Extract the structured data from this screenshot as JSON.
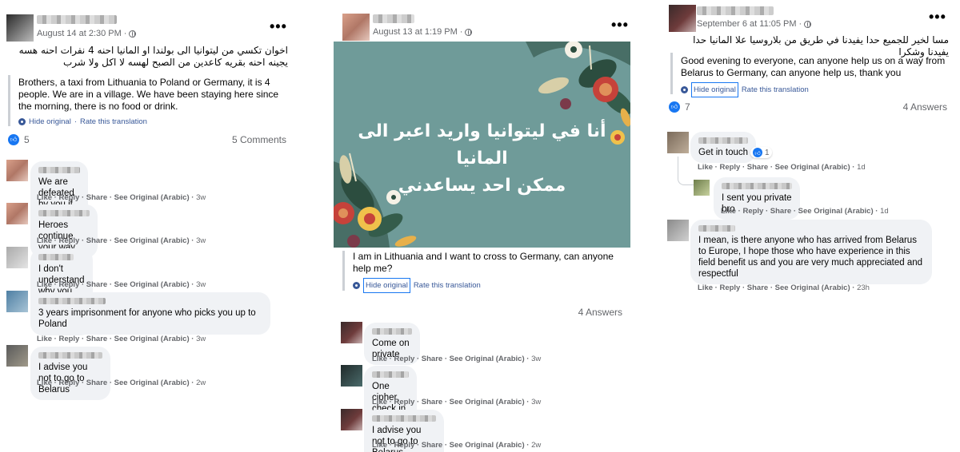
{
  "post1": {
    "date": "August 14 at 2:30 PM",
    "original_text": "اخوان تكسي من ليتوانيا الى بولندا او المانيا احنه 4 نفرات احنه هسه يجينه احنه بقريه كاعدين من الصبح لهسه لا اكل ولا شرب",
    "translation": "Brothers, a taxi from Lithuania to Poland or Germany, it is 4 people. We are in a village. We have been staying here since the morning, there is no food or drink.",
    "hide_original": "Hide original",
    "rate_translation": "Rate this translation",
    "likes": "5",
    "comments_count": "5 Comments",
    "comments": [
      {
        "text": "We are defeated by you if we enter now",
        "time": "3w"
      },
      {
        "text": "Heroes continue your way",
        "time": "3w"
      },
      {
        "text": "I don't understand why you want a taxi to reach you",
        "time": "3w"
      },
      {
        "text": "3 years imprisonment for anyone who picks you up to Poland",
        "time": "3w"
      },
      {
        "text": "I advise you not to go to Belarus",
        "time": "2w"
      }
    ]
  },
  "post2": {
    "date": "August 13 at 1:19 PM",
    "image_text_line1": "أنا في ليتوانيا واريد اعبر الى المانيا",
    "image_text_line2": "ممكن احد يساعدني",
    "translation": "I am in Lithuania and I want to cross to Germany, can anyone help me?",
    "hide_original": "Hide original",
    "rate_translation": "Rate this translation",
    "answers_count": "4 Answers",
    "comments": [
      {
        "text": "Come on private",
        "time": "3w"
      },
      {
        "text": "One cipher, check in the office.",
        "time": "3w"
      },
      {
        "text": "I advise you not to go to Belarus",
        "time": "2w"
      }
    ]
  },
  "post3": {
    "date": "September 6 at 11:05 PM",
    "original_text": "مسا لخير للجميع حدا يفيدنا في طريق من بلاروسيا علا المانيا حدا يفيدنا وشكرا",
    "translation": "Good evening to everyone, can anyone help us on a way from Belarus to Germany, can anyone help us, thank you",
    "hide_original": "Hide original",
    "rate_translation": "Rate this translation",
    "likes": "7",
    "answers_count": "4 Answers",
    "comments": [
      {
        "text": "Get in touch",
        "time": "1d",
        "reactions": "1"
      },
      {
        "text": "I sent you private bro",
        "time": "1d"
      },
      {
        "text": "I mean, is there anyone who has arrived from Belarus to Europe, I hope those who have experience in this field benefit us and you are very much appreciated and respectful",
        "time": "23h"
      }
    ]
  },
  "labels": {
    "like": "Like",
    "reply": "Reply",
    "share": "Share",
    "see_original": "See Original (Arabic)",
    "sep": "·",
    "more": "•••"
  },
  "colors": {
    "link_blue": "#385898",
    "like_blue": "#1877f2",
    "bubble_grey": "#f0f2f5",
    "meta_grey": "#65676b",
    "image_teal": "#6f9b99"
  },
  "icons": [
    "globe-icon",
    "more-options-icon",
    "translate-gear-icon",
    "like-reaction-icon",
    "flower-decoration"
  ]
}
